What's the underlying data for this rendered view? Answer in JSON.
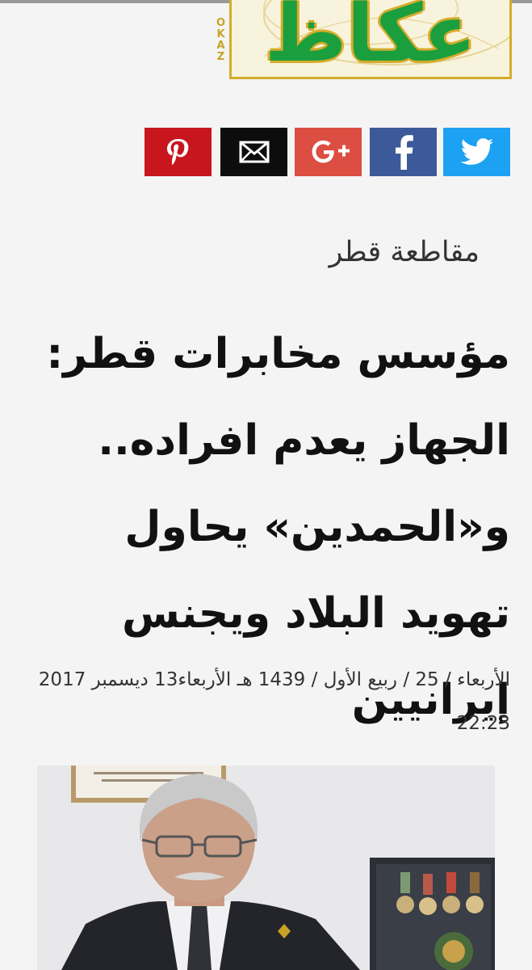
{
  "header": {
    "logo_arabic": "عكاظ",
    "logo_latin": "OKAZ"
  },
  "share": [
    {
      "name": "pinterest",
      "icon": "pinterest-icon",
      "color": "#c8161e"
    },
    {
      "name": "email",
      "icon": "envelope-icon",
      "color": "#0d0d0d"
    },
    {
      "name": "google-plus",
      "icon": "google-plus-icon",
      "label": "G+",
      "color": "#dc4e41"
    },
    {
      "name": "facebook",
      "icon": "facebook-icon",
      "color": "#3c5a99"
    },
    {
      "name": "twitter",
      "icon": "twitter-icon",
      "color": "#1da1f2"
    }
  ],
  "article": {
    "category": "مقاطعة قطر",
    "headline": "مؤسس مخابرات قطر: الجهاز يعدم افراده.. و«الحمدين» يحاول تهويد البلاد ويجنس إيرانيين",
    "dateline": "الأربعاء / 25 / ربيع الأول / 1439 هـ الأربعاء13 ديسمبر 2017 22:23",
    "photo_alt": "portrait-photo"
  }
}
